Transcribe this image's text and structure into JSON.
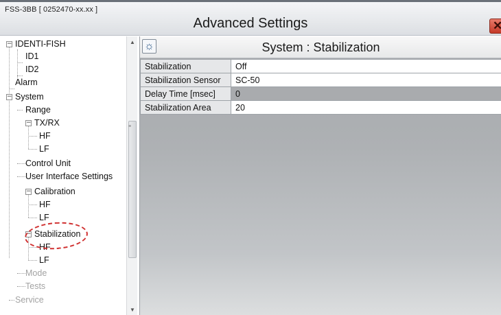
{
  "window": {
    "device_id": "FSS-3BB [ 0252470-xx.xx ]",
    "title": "Advanced Settings",
    "close_glyph": "✕"
  },
  "tree": {
    "items": [
      {
        "label": "IDENTI-FISH"
      },
      {
        "label": "ID1"
      },
      {
        "label": "ID2"
      },
      {
        "label": "Alarm"
      },
      {
        "label": "System"
      },
      {
        "label": "Range"
      },
      {
        "label": "TX/RX"
      },
      {
        "label": "HF"
      },
      {
        "label": "LF"
      },
      {
        "label": "Control Unit"
      },
      {
        "label": "User Interface Settings"
      },
      {
        "label": "Calibration"
      },
      {
        "label": "HF"
      },
      {
        "label": "LF"
      },
      {
        "label": "Stabilization"
      },
      {
        "label": "HF"
      },
      {
        "label": "LF"
      },
      {
        "label": "Mode"
      },
      {
        "label": "Tests"
      },
      {
        "label": "Service"
      }
    ],
    "scroll": {
      "up": "▲",
      "down": "▼",
      "grip": "≡"
    }
  },
  "panel": {
    "icon": "settings-gear-icon",
    "icon_glyph": "☼",
    "title": "System : Stabilization",
    "rows": [
      {
        "label": "Stabilization",
        "value": "Off"
      },
      {
        "label": "Stabilization Sensor",
        "value": "SC-50"
      },
      {
        "label": "Delay Time [msec]",
        "value": "0"
      },
      {
        "label": "Stabilization Area",
        "value": "20"
      }
    ]
  },
  "colors": {
    "highlight": "#d03030",
    "panel_bg": "#a9acaf"
  }
}
